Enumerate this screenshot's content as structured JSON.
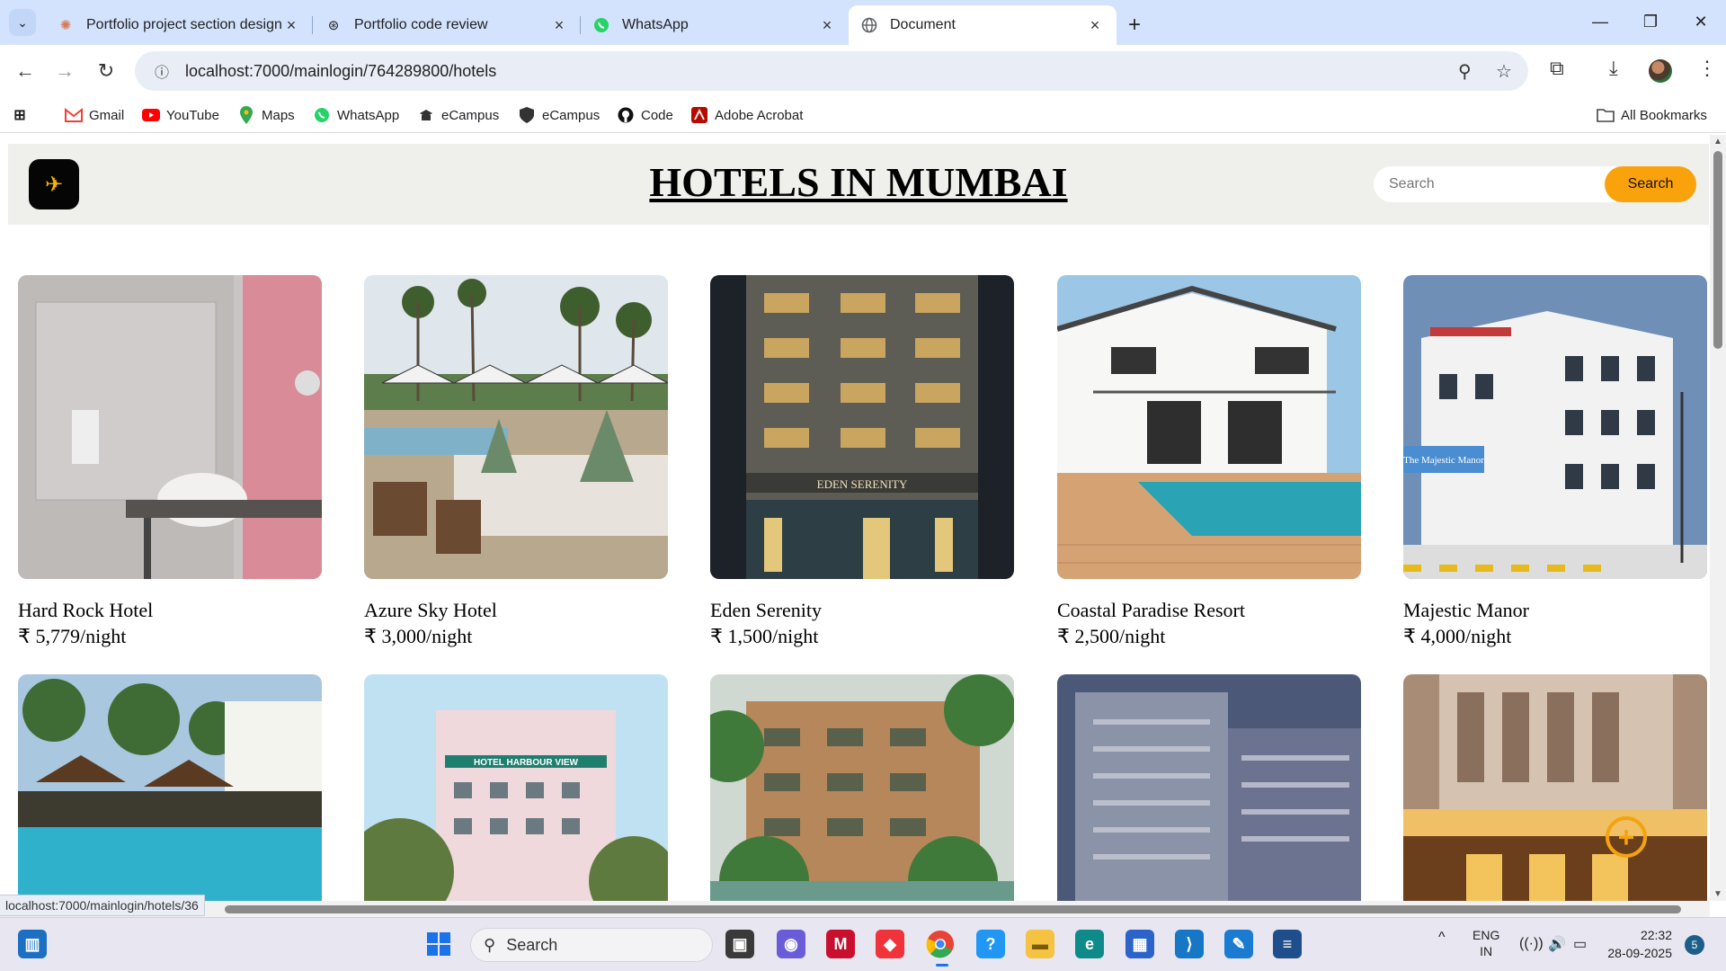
{
  "browser": {
    "tabs": [
      {
        "title": "Portfolio project section design",
        "favicon": "claude-icon",
        "color": "#d97757",
        "active": false
      },
      {
        "title": "Portfolio code review",
        "favicon": "chatgpt-icon",
        "color": "#222222",
        "active": false
      },
      {
        "title": "WhatsApp",
        "favicon": "whatsapp-icon",
        "color": "#25d366",
        "active": false
      },
      {
        "title": "Document",
        "favicon": "globe-icon",
        "color": "#5f6368",
        "active": true
      }
    ],
    "url": "localhost:7000/mainlogin/764289800/hotels",
    "status_url": "localhost:7000/mainlogin/hotels/36",
    "bookmarks": [
      {
        "label": "Gmail",
        "icon": "gmail-icon",
        "color": "#ea4335"
      },
      {
        "label": "YouTube",
        "icon": "youtube-icon",
        "color": "#ff0000"
      },
      {
        "label": "Maps",
        "icon": "maps-icon",
        "color": "#34a853"
      },
      {
        "label": "WhatsApp",
        "icon": "whatsapp-icon",
        "color": "#25d366"
      },
      {
        "label": "eCampus",
        "icon": "ecampus-icon",
        "color": "#333333"
      },
      {
        "label": "eCampus",
        "icon": "shield-icon",
        "color": "#333333"
      },
      {
        "label": "Code",
        "icon": "github-icon",
        "color": "#111111"
      },
      {
        "label": "Adobe Acrobat",
        "icon": "acrobat-icon",
        "color": "#b30b00"
      }
    ],
    "all_bookmarks": "All Bookmarks"
  },
  "page": {
    "title": "HOTELS IN MUMBAI",
    "search_placeholder": "Search",
    "search_button": "Search",
    "accent": "#f9a20b"
  },
  "hotels": [
    {
      "name": "Hard Rock Hotel",
      "price": "₹ 5,779/night"
    },
    {
      "name": "Azure Sky Hotel",
      "price": "₹ 3,000/night"
    },
    {
      "name": "Eden Serenity",
      "price": "₹ 1,500/night"
    },
    {
      "name": "Coastal Paradise Resort",
      "price": "₹ 2,500/night"
    },
    {
      "name": "Majestic Manor",
      "price": "₹ 4,000/night"
    }
  ],
  "image_signs": {
    "eden": "EDEN SERENITY",
    "majestic": "The Majestic Manor",
    "harbour": "HOTEL HARBOUR VIEW"
  },
  "taskbar": {
    "search_label": "Search",
    "language": "ENG",
    "region": "IN",
    "time": "22:32",
    "date": "28-09-2025",
    "notifications": "5"
  }
}
